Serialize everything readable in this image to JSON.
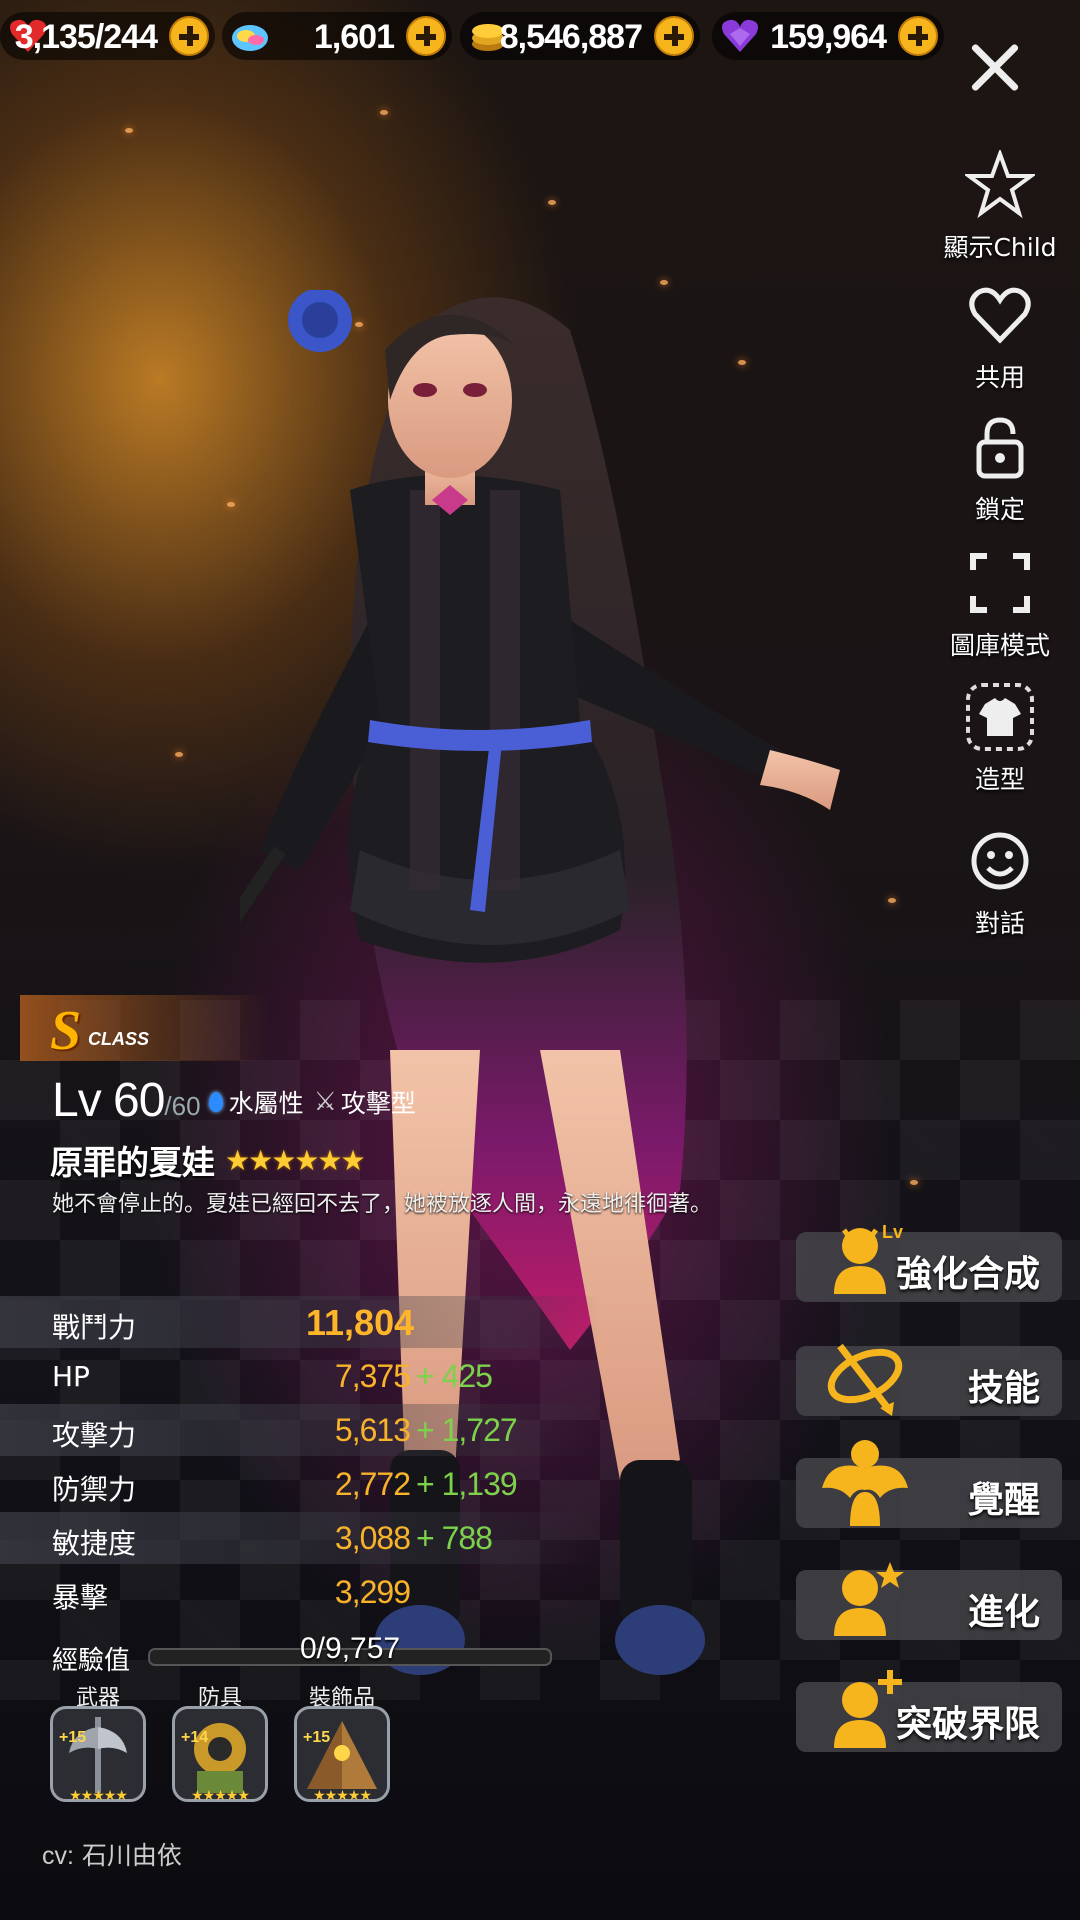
{
  "resources": [
    {
      "icon": "heart-icon",
      "value": "3,135/244"
    },
    {
      "icon": "rainbow-gem-icon",
      "value": "1,601"
    },
    {
      "icon": "gold-coin-icon",
      "value": "8,546,887"
    },
    {
      "icon": "purple-heart-gem-icon",
      "value": "159,964"
    }
  ],
  "side_menu": [
    {
      "icon": "star-icon",
      "label": "顯示Child"
    },
    {
      "icon": "heart-icon",
      "label": "共用"
    },
    {
      "icon": "lock-icon",
      "label": "鎖定"
    },
    {
      "icon": "fullscreen-icon",
      "label": "圖庫模式"
    },
    {
      "icon": "shirt-icon",
      "label": "造型"
    },
    {
      "icon": "smiley-icon",
      "label": "對話"
    }
  ],
  "character": {
    "class_letter": "S",
    "class_word": "CLASS",
    "level": "Lv 60",
    "level_max": "/60",
    "element": "水屬性",
    "type": "攻擊型",
    "name": "原罪的夏娃",
    "stars": "★★★★★★",
    "star_count": 6,
    "quote": "她不會停止的。夏娃已經回不去了，她被放逐人間，永遠地徘徊著。"
  },
  "stats": {
    "power_label": "戰鬥力",
    "power_value": "11,804",
    "rows": [
      {
        "label": "HP",
        "base": "7,375",
        "bonus": "+ 425"
      },
      {
        "label": "攻擊力",
        "base": "5,613",
        "bonus": "+ 1,727"
      },
      {
        "label": "防禦力",
        "base": "2,772",
        "bonus": "+ 1,139"
      },
      {
        "label": "敏捷度",
        "base": "3,088",
        "bonus": "+ 788"
      },
      {
        "label": "暴擊",
        "base": "3,299",
        "bonus": ""
      }
    ]
  },
  "exp": {
    "label": "經驗值",
    "text": "0/9,757",
    "fraction": 0.0
  },
  "equipment": [
    {
      "label": "武器",
      "enhance": "+15",
      "stars": "★★★★★",
      "icon": "axe-weapon-icon"
    },
    {
      "label": "防具",
      "enhance": "+14",
      "stars": "★★★★★",
      "icon": "diver-armor-icon"
    },
    {
      "label": "裝飾品",
      "enhance": "+15",
      "stars": "★★★★★",
      "icon": "pyramid-accessory-icon"
    }
  ],
  "cv": {
    "prefix": "cv:",
    "name": "石川由依"
  },
  "actions": [
    {
      "label": "強化合成",
      "icon": "level-up-icon",
      "badge": "Lv"
    },
    {
      "label": "技能",
      "icon": "skill-icon",
      "badge": ""
    },
    {
      "label": "覺醒",
      "icon": "awaken-icon",
      "badge": ""
    },
    {
      "label": "進化",
      "icon": "evolve-icon",
      "badge": ""
    },
    {
      "label": "突破界限",
      "icon": "limit-break-icon",
      "badge": ""
    }
  ],
  "colors": {
    "gold": "#f8b32a",
    "bonus_green": "#7cd24a",
    "accent_yellow": "#f6b51c"
  }
}
